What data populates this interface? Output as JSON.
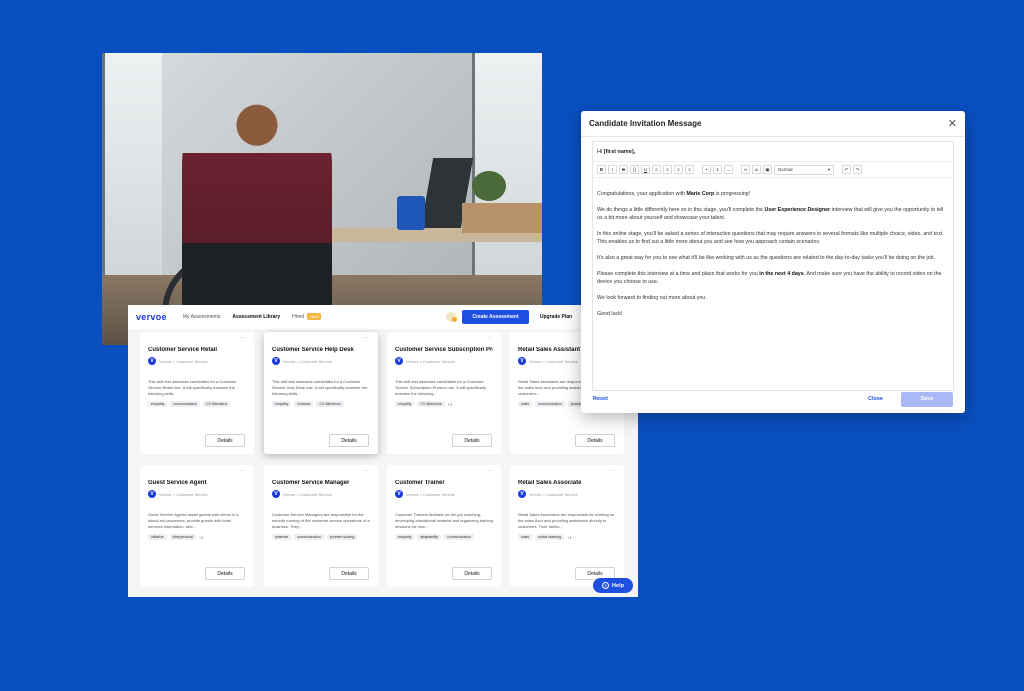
{
  "app": {
    "logo": "vervoe",
    "nav": [
      {
        "label": "My Assessments"
      },
      {
        "label": "Assessment Library"
      },
      {
        "label": "Hired",
        "badge": "New"
      }
    ],
    "create_label": "Create Assessment",
    "upgrade_label": "Upgrade Plan",
    "help_label": "Help",
    "cards": [
      {
        "title": "Customer Service Retail",
        "meta": "Vervoe > Customer Service",
        "desc": "This skill test assesses candidates for a Customer Service Retail role. It will specifically examine the following skills...",
        "tags": [
          "empathy",
          "communication",
          "CX Attentions"
        ],
        "more": "",
        "details": "Details"
      },
      {
        "title": "Customer Service Help Desk",
        "meta": "Vervoe > Customer Service",
        "desc": "This skill test assesses candidates for a Customer Service Help Desk role. It will specifically examine the following skills...",
        "tags": [
          "empathy",
          "instance",
          "CX Attentions"
        ],
        "more": "",
        "details": "Details"
      },
      {
        "title": "Customer Service Subscription Product",
        "meta": "Vervoe > Customer Service",
        "desc": "This skill test assesses candidates for a Customer Service Subscription Product role. It will specifically examine the following...",
        "tags": [
          "empathy",
          "CX Attentions"
        ],
        "more": "+1",
        "details": "Details"
      },
      {
        "title": "Retail Sales Assistant",
        "meta": "Vervoe > Customer Service",
        "desc": "Retail Sales Assistants are responsible for working on the sales floor and providing assistance directly to customers...",
        "tags": [
          "sales",
          "communication",
          "product knowledge"
        ],
        "more": "",
        "details": "Details"
      },
      {
        "title": "Guest Service Agent",
        "meta": "Vervoe > Customer Service",
        "desc": "Guest Service Agents assist guests with check-in & check-out processes, provide guests with hotel services information, and...",
        "tags": [
          "initiative",
          "interpersonal"
        ],
        "more": "+1",
        "details": "Details"
      },
      {
        "title": "Customer Service Manager",
        "meta": "Vervoe > Customer Service",
        "desc": "Customer Service Managers are responsible for the smooth running of the customer service operations of a business. They...",
        "tags": [
          "patience",
          "communication",
          "problem solving"
        ],
        "more": "",
        "details": "Details"
      },
      {
        "title": "Customer Trainer",
        "meta": "Vervoe > Customer Service",
        "desc": "Customer Trainers facilitate on-the-job coaching, developing educational material and organizing training sessions for new...",
        "tags": [
          "empathy",
          "adaptability",
          "communication"
        ],
        "more": "",
        "details": "Details"
      },
      {
        "title": "Retail Sales Associate",
        "meta": "Vervoe > Customer Service",
        "desc": "Retail Sales Associates are responsible for working on the sales floor and providing assistance directly to customers. Their duties...",
        "tags": [
          "sales",
          "active listening"
        ],
        "more": "+1",
        "details": "Details"
      }
    ]
  },
  "modal": {
    "title": "Candidate Invitation Message",
    "greeting_prefix": "Hi ",
    "greeting_name": "[first name],",
    "font_select": "Normal",
    "p1_a": "Congratulations, your application with ",
    "p1_b": "Marie Corp",
    "p1_c": " is progressing!",
    "p2_a": "We do things a little differently here so in this stage, you'll complete the ",
    "p2_b": "User Experience Designer",
    "p2_c": " interview that will give you the opportunity to tell us a bit more about yourself and showcase your talent.",
    "p3": "In this online stage, you'll be asked a series of interactive questions that may require answers in several formats like multiple choice, video, and text. This enables us to find out a little more about you and see how you approach certain scenarios.",
    "p4": "It's also a great way for you to see what it'll be like working with us as the questions are related to the day-to-day tasks you'll be doing on the job.",
    "p5_a": "Please complete this interview at a time and place that works for you ",
    "p5_b": "in the next 4 days",
    "p5_c": ". And make sure you have the ability to record video on the device you choose to use.",
    "p6": "We look forward to finding out more about you.",
    "p7": "Good luck!",
    "reset_label": "Reset",
    "close_label": "Close",
    "save_label": "Save"
  }
}
